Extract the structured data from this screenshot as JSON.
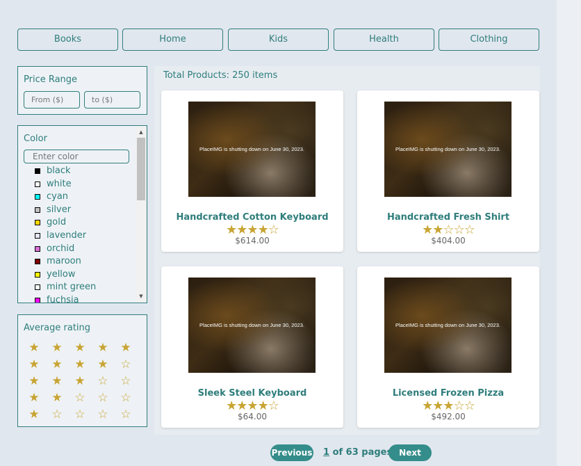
{
  "categories": [
    "Books",
    "Home",
    "Kids",
    "Health",
    "Clothing"
  ],
  "filters": {
    "price": {
      "title": "Price Range",
      "from_placeholder": "From ($)",
      "to_placeholder": "to ($)"
    },
    "color": {
      "title": "Color",
      "placeholder": "Enter color",
      "items": [
        {
          "label": "black",
          "swatch": "#000000"
        },
        {
          "label": "white",
          "swatch": "#ffffff"
        },
        {
          "label": "cyan",
          "swatch": "#00ffff"
        },
        {
          "label": "silver",
          "swatch": "#c0c0c0"
        },
        {
          "label": "gold",
          "swatch": "#ffd700"
        },
        {
          "label": "lavender",
          "swatch": "#e6e6fa"
        },
        {
          "label": "orchid",
          "swatch": "#da70d6"
        },
        {
          "label": "maroon",
          "swatch": "#800000"
        },
        {
          "label": "yellow",
          "swatch": "#ffff00"
        },
        {
          "label": "mint green",
          "swatch": "#f5fffa"
        },
        {
          "label": "fuchsia",
          "swatch": "#ff00ff"
        }
      ]
    },
    "rating": {
      "title": "Average rating",
      "rows": [
        5,
        4,
        3,
        2,
        1
      ]
    }
  },
  "results": {
    "total_label": "Total Products: 250 items"
  },
  "products": [
    {
      "name": "Handcrafted Cotton Keyboard",
      "rating": 4,
      "price": "$614.00",
      "image_text": "PlaceIMG is shutting down on June 30, 2023."
    },
    {
      "name": "Handcrafted Fresh Shirt",
      "rating": 2,
      "price": "$404.00",
      "image_text": "PlaceIMG is shutting down on June 30, 2023."
    },
    {
      "name": "Sleek Steel Keyboard",
      "rating": 4,
      "price": "$64.00",
      "image_text": "PlaceIMG is shutting down on June 30, 2023."
    },
    {
      "name": "Licensed Frozen Pizza",
      "rating": 3,
      "price": "$492.00",
      "image_text": "PlaceIMG is shutting down on June 30, 2023."
    }
  ],
  "pagination": {
    "previous_label": "Previous",
    "next_label": "Next",
    "current_page": "1",
    "of_text": " of 63 pages"
  },
  "colors": {
    "accent": "#2e7d7b",
    "button": "#348d8a",
    "star": "#c8a432"
  }
}
